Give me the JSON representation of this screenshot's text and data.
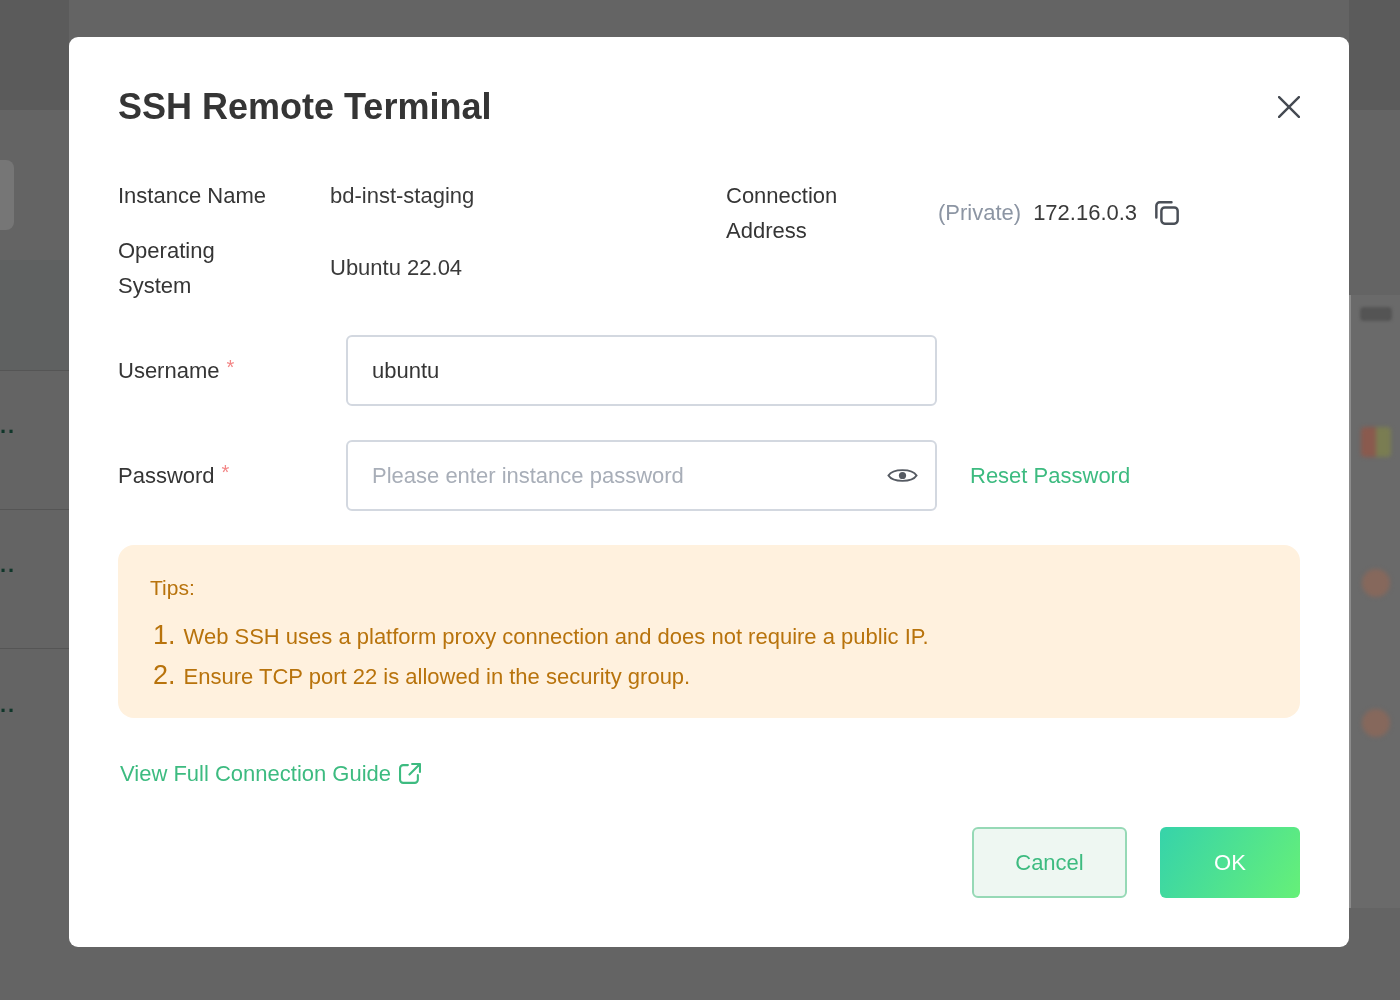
{
  "background": {
    "row_fragments": [
      "..",
      "..",
      ".."
    ]
  },
  "dialog": {
    "title": "SSH Remote Terminal",
    "detail_columns": [
      {
        "items": [
          {
            "label": "Instance Name",
            "value": "bd-inst-staging",
            "copyable": false
          },
          {
            "label": "Operating System",
            "value": "Ubuntu 22.04",
            "copyable": false
          }
        ]
      },
      {
        "items": [
          {
            "label": "Connection Address",
            "tag": "(Private)",
            "value": "172.16.0.3",
            "copyable": true
          }
        ]
      }
    ],
    "fields": [
      {
        "kind": "text",
        "label": "Username",
        "required_mark": "*",
        "value": "ubuntu"
      },
      {
        "kind": "password",
        "label": "Password",
        "required_mark": "*",
        "placeholder": "Please enter instance password",
        "link": "Reset Password"
      }
    ],
    "tips": {
      "title": "Tips:",
      "items": [
        {
          "number": "1.",
          "text": "Web SSH uses a platform proxy connection and does not require a public IP."
        },
        {
          "number": "2.",
          "text": "Ensure TCP port 22 is allowed in the security group."
        }
      ]
    },
    "guide_link": "View Full Connection Guide",
    "buttons": [
      {
        "kind": "secondary",
        "label": "Cancel"
      },
      {
        "kind": "primary",
        "label": "OK"
      }
    ]
  }
}
